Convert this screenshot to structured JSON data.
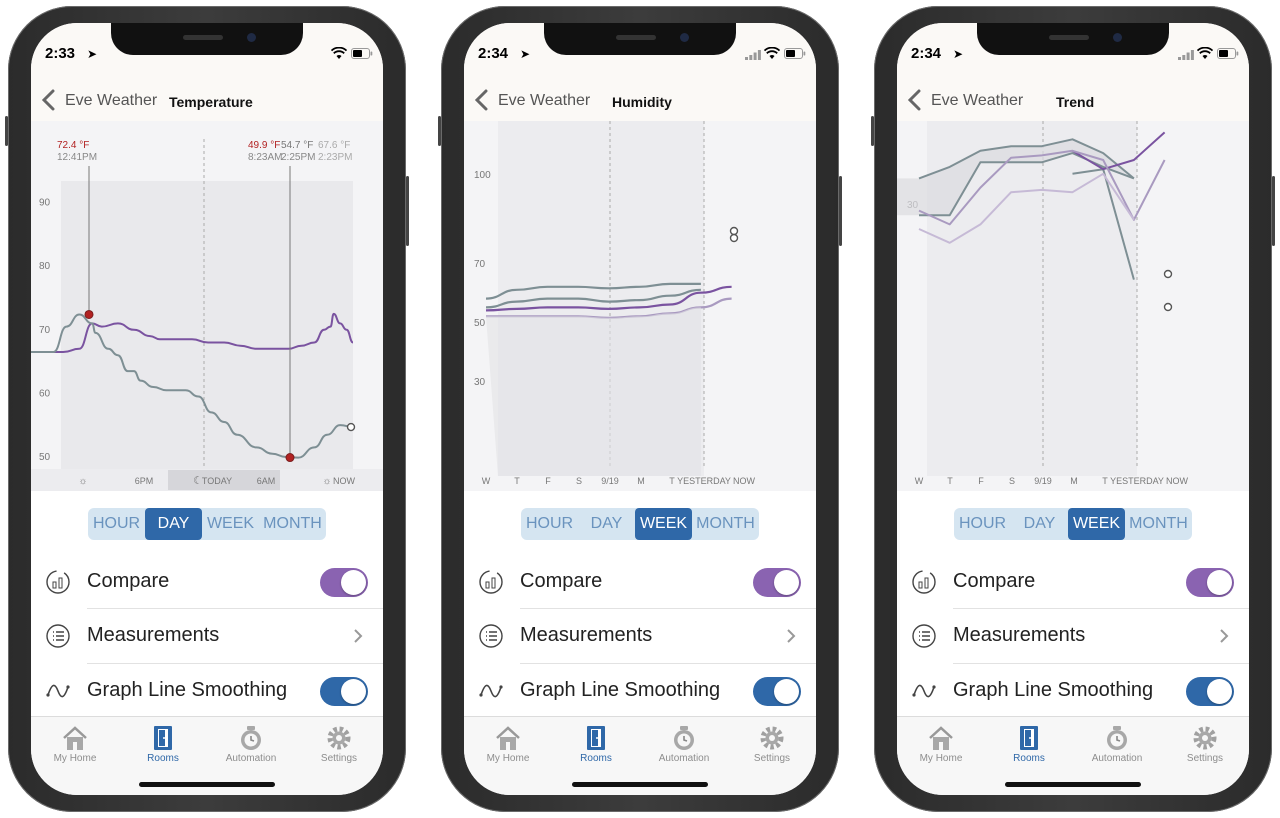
{
  "phones": [
    {
      "time": "2:33",
      "back_label": "Eve Weather",
      "title": "Temperature",
      "segments": [
        "HOUR",
        "DAY",
        "WEEK",
        "MONTH"
      ],
      "active_segment": "DAY",
      "rows": {
        "compare": "Compare",
        "measurements": "Measurements",
        "smoothing": "Graph Line Smoothing"
      },
      "tabs": [
        "My Home",
        "Rooms",
        "Automation",
        "Settings"
      ],
      "active_tab": "Rooms",
      "chart_data": {
        "type": "line",
        "y_ticks": [
          "90",
          "80",
          "70",
          "60",
          "50"
        ],
        "ylim": [
          47,
          100
        ],
        "x_ticks": [
          "6PM",
          "TODAY",
          "6AM",
          "NOW"
        ],
        "annotations": [
          {
            "value": "72.4 °F",
            "time": "12:41PM"
          },
          {
            "value": "49.9 °F",
            "time": "8:23AM"
          },
          {
            "value": "54.7 °F",
            "time": "2:25PM"
          },
          {
            "value": "67.6 °F",
            "time": "2:23PM"
          }
        ],
        "series": [
          {
            "name": "",
            "color": "#7a53a0",
            "x": [
              0.0,
              0.1,
              0.15,
              0.19,
              0.22,
              0.27,
              0.32,
              0.37,
              0.4,
              0.5,
              0.55,
              0.6,
              0.65,
              0.7,
              0.8,
              0.84,
              0.88,
              0.91,
              0.93,
              0.94,
              0.96,
              0.98,
              1.0
            ],
            "y": [
              66.5,
              66.5,
              67,
              71,
              70.5,
              71,
              70,
              69,
              68.5,
              68.5,
              68,
              68,
              67.5,
              67,
              67,
              67.5,
              68,
              70,
              70.5,
              72.5,
              71,
              70,
              68
            ]
          },
          {
            "name": "",
            "color": "#7e8f94",
            "x": [
              0.0,
              0.07,
              0.11,
              0.15,
              0.19,
              0.2,
              0.24,
              0.27,
              0.3,
              0.32,
              0.34,
              0.38,
              0.42,
              0.48,
              0.52,
              0.56,
              0.6,
              0.64,
              0.7,
              0.75,
              0.79,
              0.83,
              0.88,
              0.92,
              0.96,
              1.0
            ],
            "y": [
              66.5,
              66.5,
              70.5,
              72.4,
              71,
              69.5,
              67,
              66,
              63.5,
              63.5,
              62,
              61,
              60.5,
              60.5,
              59.5,
              57,
              55.5,
              53.5,
              51.5,
              50.5,
              50,
              49.9,
              51.5,
              53.5,
              55,
              54.7
            ]
          }
        ]
      }
    },
    {
      "time": "2:34",
      "back_label": "Eve Weather",
      "title": "Humidity",
      "segments": [
        "HOUR",
        "DAY",
        "WEEK",
        "MONTH"
      ],
      "active_segment": "WEEK",
      "rows": {
        "compare": "Compare",
        "measurements": "Measurements",
        "smoothing": "Graph Line Smoothing"
      },
      "tabs": [
        "My Home",
        "Rooms",
        "Automation",
        "Settings"
      ],
      "active_tab": "Rooms",
      "chart_data": {
        "type": "area",
        "y_ticks": [
          "100",
          "70",
          "50",
          "30"
        ],
        "ylim": [
          10,
          110
        ],
        "x_ticks": [
          "W",
          "T",
          "F",
          "S",
          "9/19",
          "M",
          "T",
          "YESTERDAY",
          "NOW"
        ],
        "series": [
          {
            "name": "",
            "color": "#7e8f94",
            "x": [
              0,
              1,
              2,
              3,
              4,
              5,
              6,
              7
            ],
            "y": [
              72,
              75,
              76,
              76,
              75.5,
              76,
              77,
              77
            ]
          },
          {
            "name": "",
            "color": "#7e8f94",
            "x": [
              0,
              1,
              2,
              3,
              4,
              5,
              6,
              7
            ],
            "y": [
              69,
              71,
              72,
              72,
              71,
              71.5,
              73,
              75
            ]
          },
          {
            "name": "",
            "color": "#7a53a0",
            "x": [
              0,
              1,
              2,
              3,
              4,
              5,
              6,
              7,
              8
            ],
            "y": [
              68,
              68.5,
              69,
              69,
              68.5,
              69,
              70,
              74,
              76
            ]
          },
          {
            "name": "",
            "color": "#a99ac0",
            "x": [
              0,
              1,
              2,
              3,
              4,
              5,
              6,
              7,
              8
            ],
            "y": [
              66,
              66,
              66,
              66,
              65.5,
              66,
              67,
              69,
              72
            ]
          }
        ]
      }
    },
    {
      "time": "2:34",
      "back_label": "Eve Weather",
      "title": "Trend",
      "segments": [
        "HOUR",
        "DAY",
        "WEEK",
        "MONTH"
      ],
      "active_segment": "WEEK",
      "rows": {
        "compare": "Compare",
        "measurements": "Measurements",
        "smoothing": "Graph Line Smoothing"
      },
      "tabs": [
        "My Home",
        "Rooms",
        "Automation",
        "Settings"
      ],
      "active_tab": "Rooms",
      "chart_data": {
        "type": "line",
        "y_ticks": [
          "30"
        ],
        "ylim": [
          0,
          40
        ],
        "x_ticks": [
          "W",
          "T",
          "F",
          "S",
          "9/19",
          "M",
          "T",
          "YESTERDAY",
          "NOW"
        ],
        "series": [
          {
            "name": "",
            "color": "#7e8f94",
            "x": [
              0,
              1,
              2,
              3,
              4,
              5,
              6,
              7
            ],
            "y": [
              31,
              33.5,
              37,
              38,
              38,
              39.5,
              36.5,
              31
            ]
          },
          {
            "name": "",
            "color": "#7e8f94",
            "x": [
              0,
              1,
              2,
              3,
              4,
              5,
              6,
              7
            ],
            "y": [
              23,
              23,
              34.5,
              34.5,
              34.5,
              36.5,
              33.5,
              31
            ]
          },
          {
            "name": "",
            "color": "#7e8f94",
            "x": [
              5,
              6,
              7
            ],
            "y": [
              32,
              33,
              9
            ]
          },
          {
            "name": "",
            "color": "#7a53a0",
            "x": [
              5,
              6,
              7,
              8
            ],
            "y": [
              37,
              33,
              35,
              41
            ]
          },
          {
            "name": "",
            "color": "#a99ac0",
            "x": [
              0,
              1,
              2,
              3,
              4,
              5,
              6,
              7,
              8
            ],
            "y": [
              24,
              21,
              29,
              35.5,
              36,
              37,
              35,
              22,
              35
            ]
          },
          {
            "name": "",
            "color": "#c6bad6",
            "x": [
              0,
              1,
              2,
              3,
              4,
              5,
              6,
              7
            ],
            "y": [
              20,
              17,
              21,
              28,
              28.5,
              28,
              32,
              22
            ]
          }
        ]
      }
    }
  ]
}
